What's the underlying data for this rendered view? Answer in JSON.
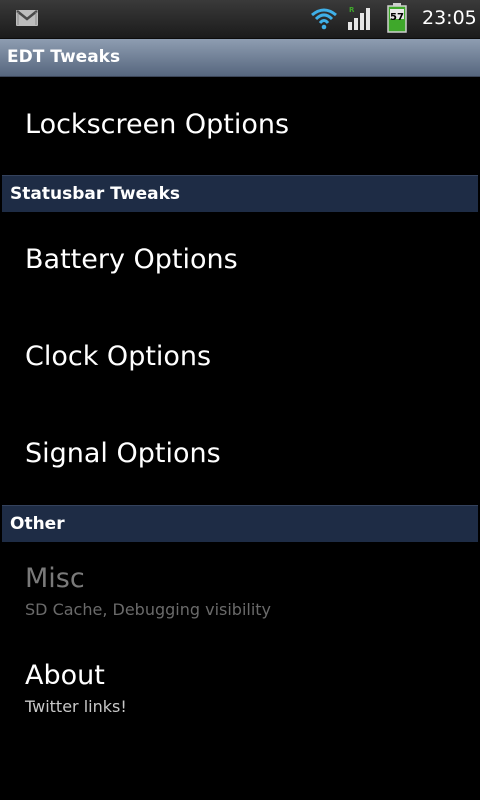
{
  "status_bar": {
    "time": "23:05",
    "battery_level": "57",
    "icons": [
      "gmail-icon",
      "wifi-icon",
      "signal-icon",
      "battery-icon"
    ],
    "colors": {
      "battery": "#3fa82b",
      "background": "#262626"
    }
  },
  "title_bar": {
    "title": "EDT Tweaks",
    "colors": {
      "background": "#74849b"
    }
  },
  "preferences": {
    "lockscreen": {
      "label": "Lockscreen Options"
    },
    "category_statusbar": {
      "label": "Statusbar Tweaks"
    },
    "battery": {
      "label": "Battery Options"
    },
    "clock": {
      "label": "Clock Options"
    },
    "signal": {
      "label": "Signal Options"
    },
    "category_other": {
      "label": "Other"
    },
    "misc": {
      "label": "Misc",
      "summary": "SD Cache, Debugging visibility",
      "enabled": false
    },
    "about": {
      "label": "About",
      "summary": "Twitter links!"
    }
  },
  "colors": {
    "category_background": "#1e2c45",
    "list_background": "#000000"
  }
}
